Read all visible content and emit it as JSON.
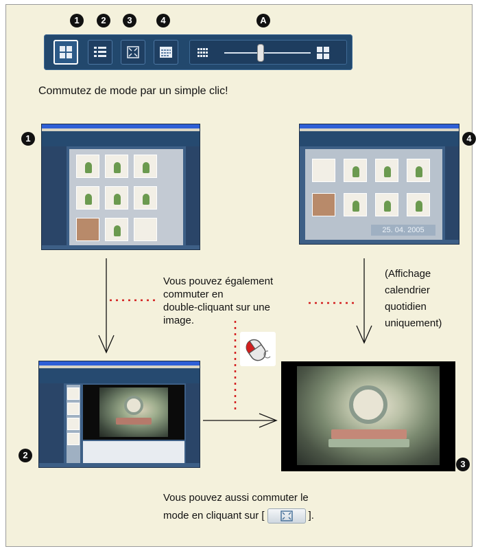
{
  "toolbar": {
    "markers": [
      "1",
      "2",
      "3",
      "4",
      "A"
    ],
    "buttons": [
      {
        "name": "thumbnail-mode",
        "icon": "grid-icon"
      },
      {
        "name": "list-mode",
        "icon": "list-icon"
      },
      {
        "name": "fullscreen-mode",
        "icon": "fullscreen-icon"
      },
      {
        "name": "calendar-mode",
        "icon": "calendar-icon"
      }
    ],
    "slider": {
      "min_icon": "small-grid-icon",
      "max_icon": "large-grid-icon",
      "level": 0.45
    }
  },
  "captions": {
    "switch_mode": "Commutez de mode par un simple clic!",
    "double_click_line1": "Vous pouvez également",
    "double_click_line2": "commuter en",
    "double_click_line3": "double-cliquant sur une",
    "double_click_line4": "image.",
    "calendar_line1": "(Affichage",
    "calendar_line2": "calendrier",
    "calendar_line3": "quotidien",
    "calendar_line4": "uniquement)",
    "bottom_line1": "Vous pouvez aussi commuter le",
    "bottom_line2_a": "mode en cliquant sur [",
    "bottom_line2_b": "]."
  },
  "screens": {
    "screen1_marker": "1",
    "screen2_marker": "2",
    "screen3_marker": "3",
    "screen4_marker": "4",
    "calendar_date": "25. 04. 2005"
  },
  "colors": {
    "background": "#f4f1dc",
    "toolbar": "#22486d",
    "dotted_line": "#d32020"
  }
}
